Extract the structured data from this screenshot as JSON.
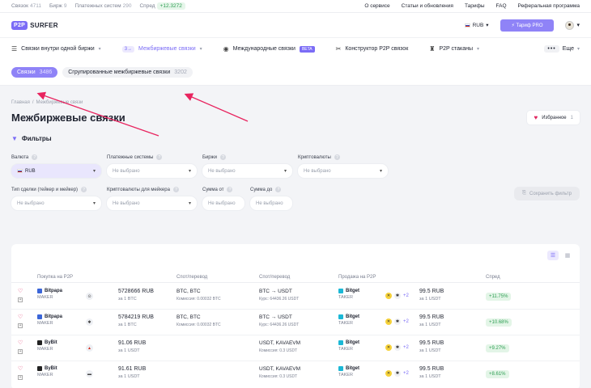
{
  "topbar": {
    "stats": [
      {
        "label": "Связок",
        "value": "4711"
      },
      {
        "label": "Бирж",
        "value": "9"
      },
      {
        "label": "Платежных систем",
        "value": "290"
      }
    ],
    "spread_label": "Спред",
    "spread_value": "+12.3272",
    "links": [
      "О сервисе",
      "Статьи и обновления",
      "Тарифы",
      "FAQ",
      "Реферальная программа"
    ]
  },
  "header": {
    "logo_p2p": "P2P",
    "logo_text": "SURFER",
    "currency": "RUB",
    "tariff_button": "Тариф PRO"
  },
  "nav": {
    "items": [
      {
        "label": "Связки внутри одной биржи",
        "icon": "sliders-icon"
      },
      {
        "label": "Межбиржевые связки",
        "icon": "arrows-icon",
        "icon_text": "3→"
      },
      {
        "label": "Международные связки",
        "icon": "globe-icon",
        "badge": "BETA"
      },
      {
        "label": "Конструктор P2P связок",
        "icon": "tools-icon"
      },
      {
        "label": "P2P стаканы",
        "icon": "cup-icon"
      }
    ],
    "more_label": "Еще"
  },
  "tabs": [
    {
      "label": "Связки",
      "count": "3486"
    },
    {
      "label": "Сгрупированные межбиржевые связки",
      "count": "3202"
    }
  ],
  "breadcrumb": [
    "Главная",
    "/",
    "Межбиржевые связи"
  ],
  "page_title": "Межбиржевые связки",
  "favorites": {
    "label": "Избранное",
    "count": "1"
  },
  "filters": {
    "title": "Фильтры",
    "fields": [
      {
        "label": "Валюта",
        "value": "RUB"
      },
      {
        "label": "Платежные системы",
        "value": "Не выбрано"
      },
      {
        "label": "Биржи",
        "value": "Не выбрано"
      },
      {
        "label": "Криптовалюты",
        "value": "Не выбрано"
      },
      {
        "label": "Тип сделки (тейкер и мейкер)",
        "value": "Не выбрано"
      },
      {
        "label": "Криптовалюты для мейкера",
        "value": "Не выбрано"
      },
      {
        "label": "Сумма от",
        "value": "Не выбрано"
      },
      {
        "label": "Сумма до",
        "value": "Не выбрано"
      }
    ],
    "save_button": "Сохранить фильтр"
  },
  "table": {
    "headers": [
      "Покупка на P2P",
      "Спот/перевод",
      "Спот/перевод",
      "Продажа на P2P",
      "Спред"
    ],
    "rows": [
      {
        "buy_exchange": "Bitpapa",
        "buy_role": "MAKER",
        "pm_icon": "⊙",
        "buy_price": "5728666 RUB",
        "buy_sub": "за 1 BTC",
        "spot1": "BTC, BTC",
        "spot1_sub": "Комиссия: 0.00032 BTC",
        "spot2": "BTC → USDT",
        "spot2_sub": "Курс: 64436.26 USDT",
        "sell_exchange": "Bitget",
        "sell_role": "TAKER",
        "more": "+2",
        "sell_price": "99.5 RUB",
        "sell_sub": "за 1 USDT",
        "spread": "+11.75%"
      },
      {
        "buy_exchange": "Bitpapa",
        "buy_role": "MAKER",
        "pm_icon": "✱",
        "buy_price": "5784219 RUB",
        "buy_sub": "за 1 BTC",
        "spot1": "BTC, BTC",
        "spot1_sub": "Комиссия: 0.00032 BTC",
        "spot2": "BTC → USDT",
        "spot2_sub": "Курс: 64436.26 USDT",
        "sell_exchange": "Bitget",
        "sell_role": "TAKER",
        "more": "+2",
        "sell_price": "99.5 RUB",
        "sell_sub": "за 1 USDT",
        "spread": "+10.68%"
      },
      {
        "buy_exchange": "ByBit",
        "buy_role": "MAKER",
        "pm_icon": "▲",
        "buy_price": "91.06 RUB",
        "buy_sub": "за 1 USDT",
        "spot1": "",
        "spot1_sub": "",
        "spot2": "USDT, KAVAEVM",
        "spot2_sub": "Комиссия: 0.3 USDT",
        "sell_exchange": "Bitget",
        "sell_role": "TAKER",
        "more": "+2",
        "sell_price": "99.5 RUB",
        "sell_sub": "за 1 USDT",
        "spread": "+9.27%"
      },
      {
        "buy_exchange": "ByBit",
        "buy_role": "MAKER",
        "pm_icon": "▬",
        "buy_price": "91.61 RUB",
        "buy_sub": "за 1 USDT",
        "spot1": "",
        "spot1_sub": "",
        "spot2": "USDT, KAVAEVM",
        "spot2_sub": "Комиссия: 0.3 USDT",
        "sell_exchange": "Bitget",
        "sell_role": "TAKER",
        "more": "+2",
        "sell_price": "99.5 RUB",
        "sell_sub": "за 1 USDT",
        "spread": "+8.61%"
      }
    ]
  },
  "colors": {
    "accent": "#7b6cf6",
    "annotation": "#e8245f",
    "spread_green": "#2f9e54"
  }
}
